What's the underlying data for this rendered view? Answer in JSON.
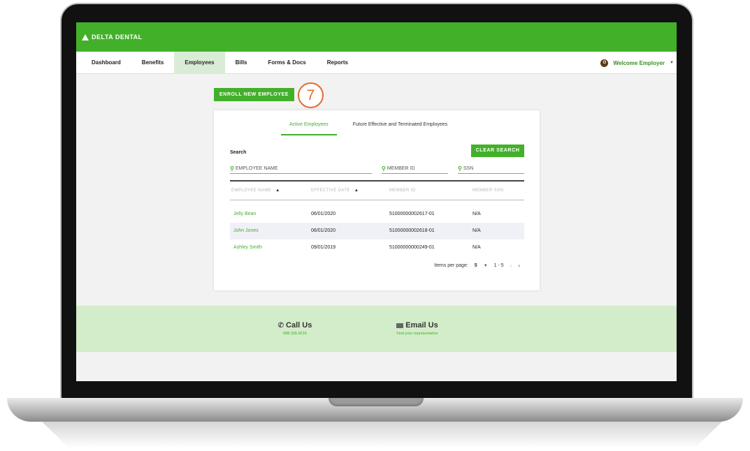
{
  "brand": {
    "logo_text": "DELTA DENTAL",
    "accent": "#43b02a"
  },
  "nav": {
    "items": [
      {
        "label": "Dashboard"
      },
      {
        "label": "Benefits"
      },
      {
        "label": "Employees"
      },
      {
        "label": "Bills"
      },
      {
        "label": "Forms & Docs"
      },
      {
        "label": "Reports"
      }
    ],
    "active": "Employees",
    "welcome": "Welcome Employer",
    "avatar_initial": "O"
  },
  "actions": {
    "enroll_label": "ENROLL NEW EMPLOYEE",
    "step_number": "7"
  },
  "tabs": [
    {
      "label": "Active Employees"
    },
    {
      "label": "Future Effective and Terminated Employees"
    }
  ],
  "search": {
    "label": "Search",
    "clear_label": "CLEAR SEARCH",
    "employee_placeholder": "EMPLOYEE NAME",
    "member_placeholder": "MEMBER ID",
    "ssn_placeholder": "SSN"
  },
  "table": {
    "headers": [
      "EMPLOYEE NAME",
      "EFFECTIVE DATE",
      "MEMBER ID",
      "MEMBER SSN"
    ],
    "rows": [
      [
        "Jelly Bean",
        "06/01/2020",
        "51000000002617-01",
        "N/A"
      ],
      [
        "John Jones",
        "06/01/2020",
        "51000000002618-01",
        "N/A"
      ],
      [
        "Ashley Smith",
        "09/01/2019",
        "51000000000249-01",
        "N/A"
      ]
    ]
  },
  "pagination": {
    "label": "Items per page:",
    "per_page": "5",
    "range": "1 - 5"
  },
  "footer": {
    "call_title": "Call Us",
    "call_sub": "888.335.8216",
    "email_title": "Email Us",
    "email_sub": "Find your representative"
  }
}
